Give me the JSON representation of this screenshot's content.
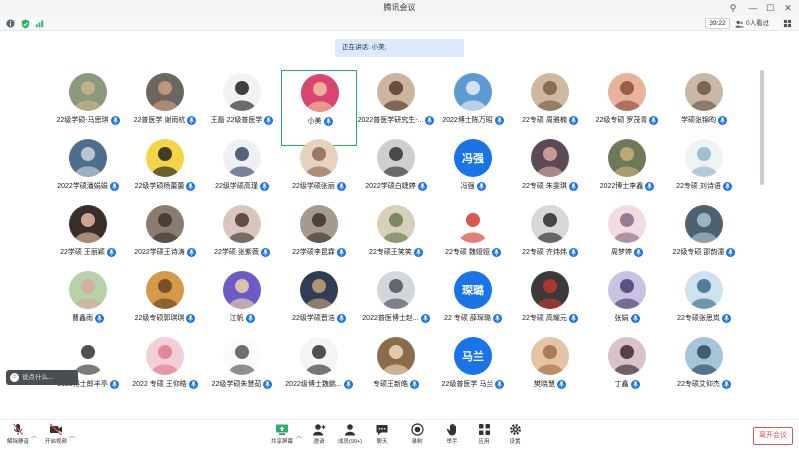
{
  "window": {
    "title": "腾讯会议"
  },
  "status": {
    "timer": "39:22",
    "share_count": "0人看过",
    "info_icon": "info-icon",
    "shield_icon": "shield-icon",
    "signal_icon": "signal-icon"
  },
  "speaking": {
    "text": "正在讲话: 小美;"
  },
  "colors": {
    "accent": "#1a74e8",
    "active_border": "#22b35e",
    "leave": "#e2534f"
  },
  "participants": [
    [
      {
        "name": "22级学硕-马思琪",
        "bg": "#8a9a7b",
        "fg": "#c9b38c"
      },
      {
        "name": "22普医学 谢雨杭",
        "bg": "#6b6660",
        "fg": "#cf9c7c"
      },
      {
        "name": "王磊 22级普医学",
        "bg": "#f2f2f2",
        "fg": "#222222"
      },
      {
        "name": "小美",
        "bg": "#d8466f",
        "fg": "#f3c2a5"
      },
      {
        "name": "2022普医学研究生-...",
        "bg": "#ccb59e",
        "fg": "#5a3a2a"
      },
      {
        "name": "2022博士陈万昭",
        "bg": "#5c9bd1",
        "fg": "#e9eef3"
      },
      {
        "name": "22专硕 周雅楠",
        "bg": "#cdb8a2",
        "fg": "#7b5d46"
      },
      {
        "name": "22级专硕 罗茂青",
        "bg": "#e8b39a",
        "fg": "#8d4f3c"
      },
      {
        "name": "学硕张锦昀",
        "bg": "#c9b8a6",
        "fg": "#6d5949"
      }
    ],
    [
      {
        "name": "2022学硕潘娟娟",
        "bg": "#4f6e8c",
        "fg": "#c9d5e0"
      },
      {
        "name": "22级学硕杨蕾蕾",
        "bg": "#f5d547",
        "fg": "#222222"
      },
      {
        "name": "22级学硕高瑾",
        "bg": "#eef0f5",
        "fg": "#3a4a6a"
      },
      {
        "name": "22级学硕张丽",
        "bg": "#e6d2bf",
        "fg": "#8d6b52"
      },
      {
        "name": "2022学硕白婕婷",
        "bg": "#cfcfcf",
        "fg": "#333333"
      },
      {
        "name": "冯强",
        "bg": "#1a74e8",
        "fg": "#ffffff",
        "text": "冯强"
      },
      {
        "name": "22专硕 朱雯琪",
        "bg": "#5b4a55",
        "fg": "#d9a7a0"
      },
      {
        "name": "2022博士李鑫",
        "bg": "#6d7a5a",
        "fg": "#c8b07a"
      },
      {
        "name": "22专硕 刘诗语",
        "bg": "#eef3f6",
        "fg": "#8fb4c6"
      }
    ],
    [
      {
        "name": "22学硕 王丽颖",
        "bg": "#3a2e2a",
        "fg": "#e3b8a0"
      },
      {
        "name": "2022学硕王诗涛",
        "bg": "#8b7c6d",
        "fg": "#3e3530"
      },
      {
        "name": "22学硕 张紫薇",
        "bg": "#d9c7bd",
        "fg": "#4a3a35"
      },
      {
        "name": "22学硕李昆霖",
        "bg": "#a69a8c",
        "fg": "#3d342c"
      },
      {
        "name": "22专硕王笑笑",
        "bg": "#d7d0b8",
        "fg": "#6a7a4f"
      },
      {
        "name": "22专硕 魏娅娅",
        "bg": "#ffffff",
        "fg": "#d23b2f"
      },
      {
        "name": "22专硕 齐炜炜",
        "bg": "#d8d8d8",
        "fg": "#2a2a2a"
      },
      {
        "name": "周梦婷",
        "bg": "#f1dce2",
        "fg": "#8c6a86"
      },
      {
        "name": "22级专硕 邵韵潼",
        "bg": "#4a6272",
        "fg": "#aac4d2"
      }
    ],
    [
      {
        "name": "曹鑫雨",
        "bg": "#b6d3a8",
        "fg": "#d8a8a0"
      },
      {
        "name": "22级专硕郭琪琪",
        "bg": "#d49a4a",
        "fg": "#6a4420"
      },
      {
        "name": "江帆",
        "bg": "#6a5cc4",
        "fg": "#f0d2a8"
      },
      {
        "name": "22级学硕晋浩",
        "bg": "#2f3d55",
        "fg": "#c4a27a"
      },
      {
        "name": "2022普医博士赵...",
        "bg": "#d3d7dc",
        "fg": "#4a5560"
      },
      {
        "name": "22 专硕 薛琛璐",
        "bg": "#1a74e8",
        "fg": "#ffffff",
        "text": "琛璐"
      },
      {
        "name": "22专硕 高耀元",
        "bg": "#3a3a3a",
        "fg": "#c0392b"
      },
      {
        "name": "张娟",
        "bg": "#c9c2e0",
        "fg": "#4a3d6d"
      },
      {
        "name": "22专硕张思岚",
        "bg": "#cfe2ef",
        "fg": "#3e6d8c"
      }
    ],
    [
      {
        "name": "2023博士郎丰亭",
        "bg": "#ffffff",
        "fg": "#333333"
      },
      {
        "name": "2022 专硕 王仰皓",
        "bg": "#f3cfd6",
        "fg": "#e07a8e"
      },
      {
        "name": "22级学硕朱慧茹",
        "bg": "#fafafa",
        "fg": "#555555"
      },
      {
        "name": "2022级博士魏鹏...",
        "bg": "#f4f4f4",
        "fg": "#333333"
      },
      {
        "name": "专硕王新皓",
        "bg": "#8b6b4a",
        "fg": "#f0d8b8"
      },
      {
        "name": "22级普医学 马兰",
        "bg": "#1a74e8",
        "fg": "#ffffff",
        "text": "马兰"
      },
      {
        "name": "樊晓慧",
        "bg": "#e5c3a5",
        "fg": "#a26f4a"
      },
      {
        "name": "丁鑫",
        "bg": "#d9c3c8",
        "fg": "#3a2a2e"
      },
      {
        "name": "22专硕艾仰杰",
        "bg": "#a7c4d9",
        "fg": "#2f4a5e"
      }
    ]
  ],
  "chat": {
    "placeholder": "说点什么..."
  },
  "toolbar": {
    "mute": "解除静音",
    "video": "开启视频",
    "share": "共享屏幕",
    "invite": "邀请",
    "members": "成员(99+)",
    "chat": "聊天",
    "record": "录制",
    "raise": "举手",
    "apps": "应用",
    "settings": "设置",
    "leave": "离开会议"
  }
}
